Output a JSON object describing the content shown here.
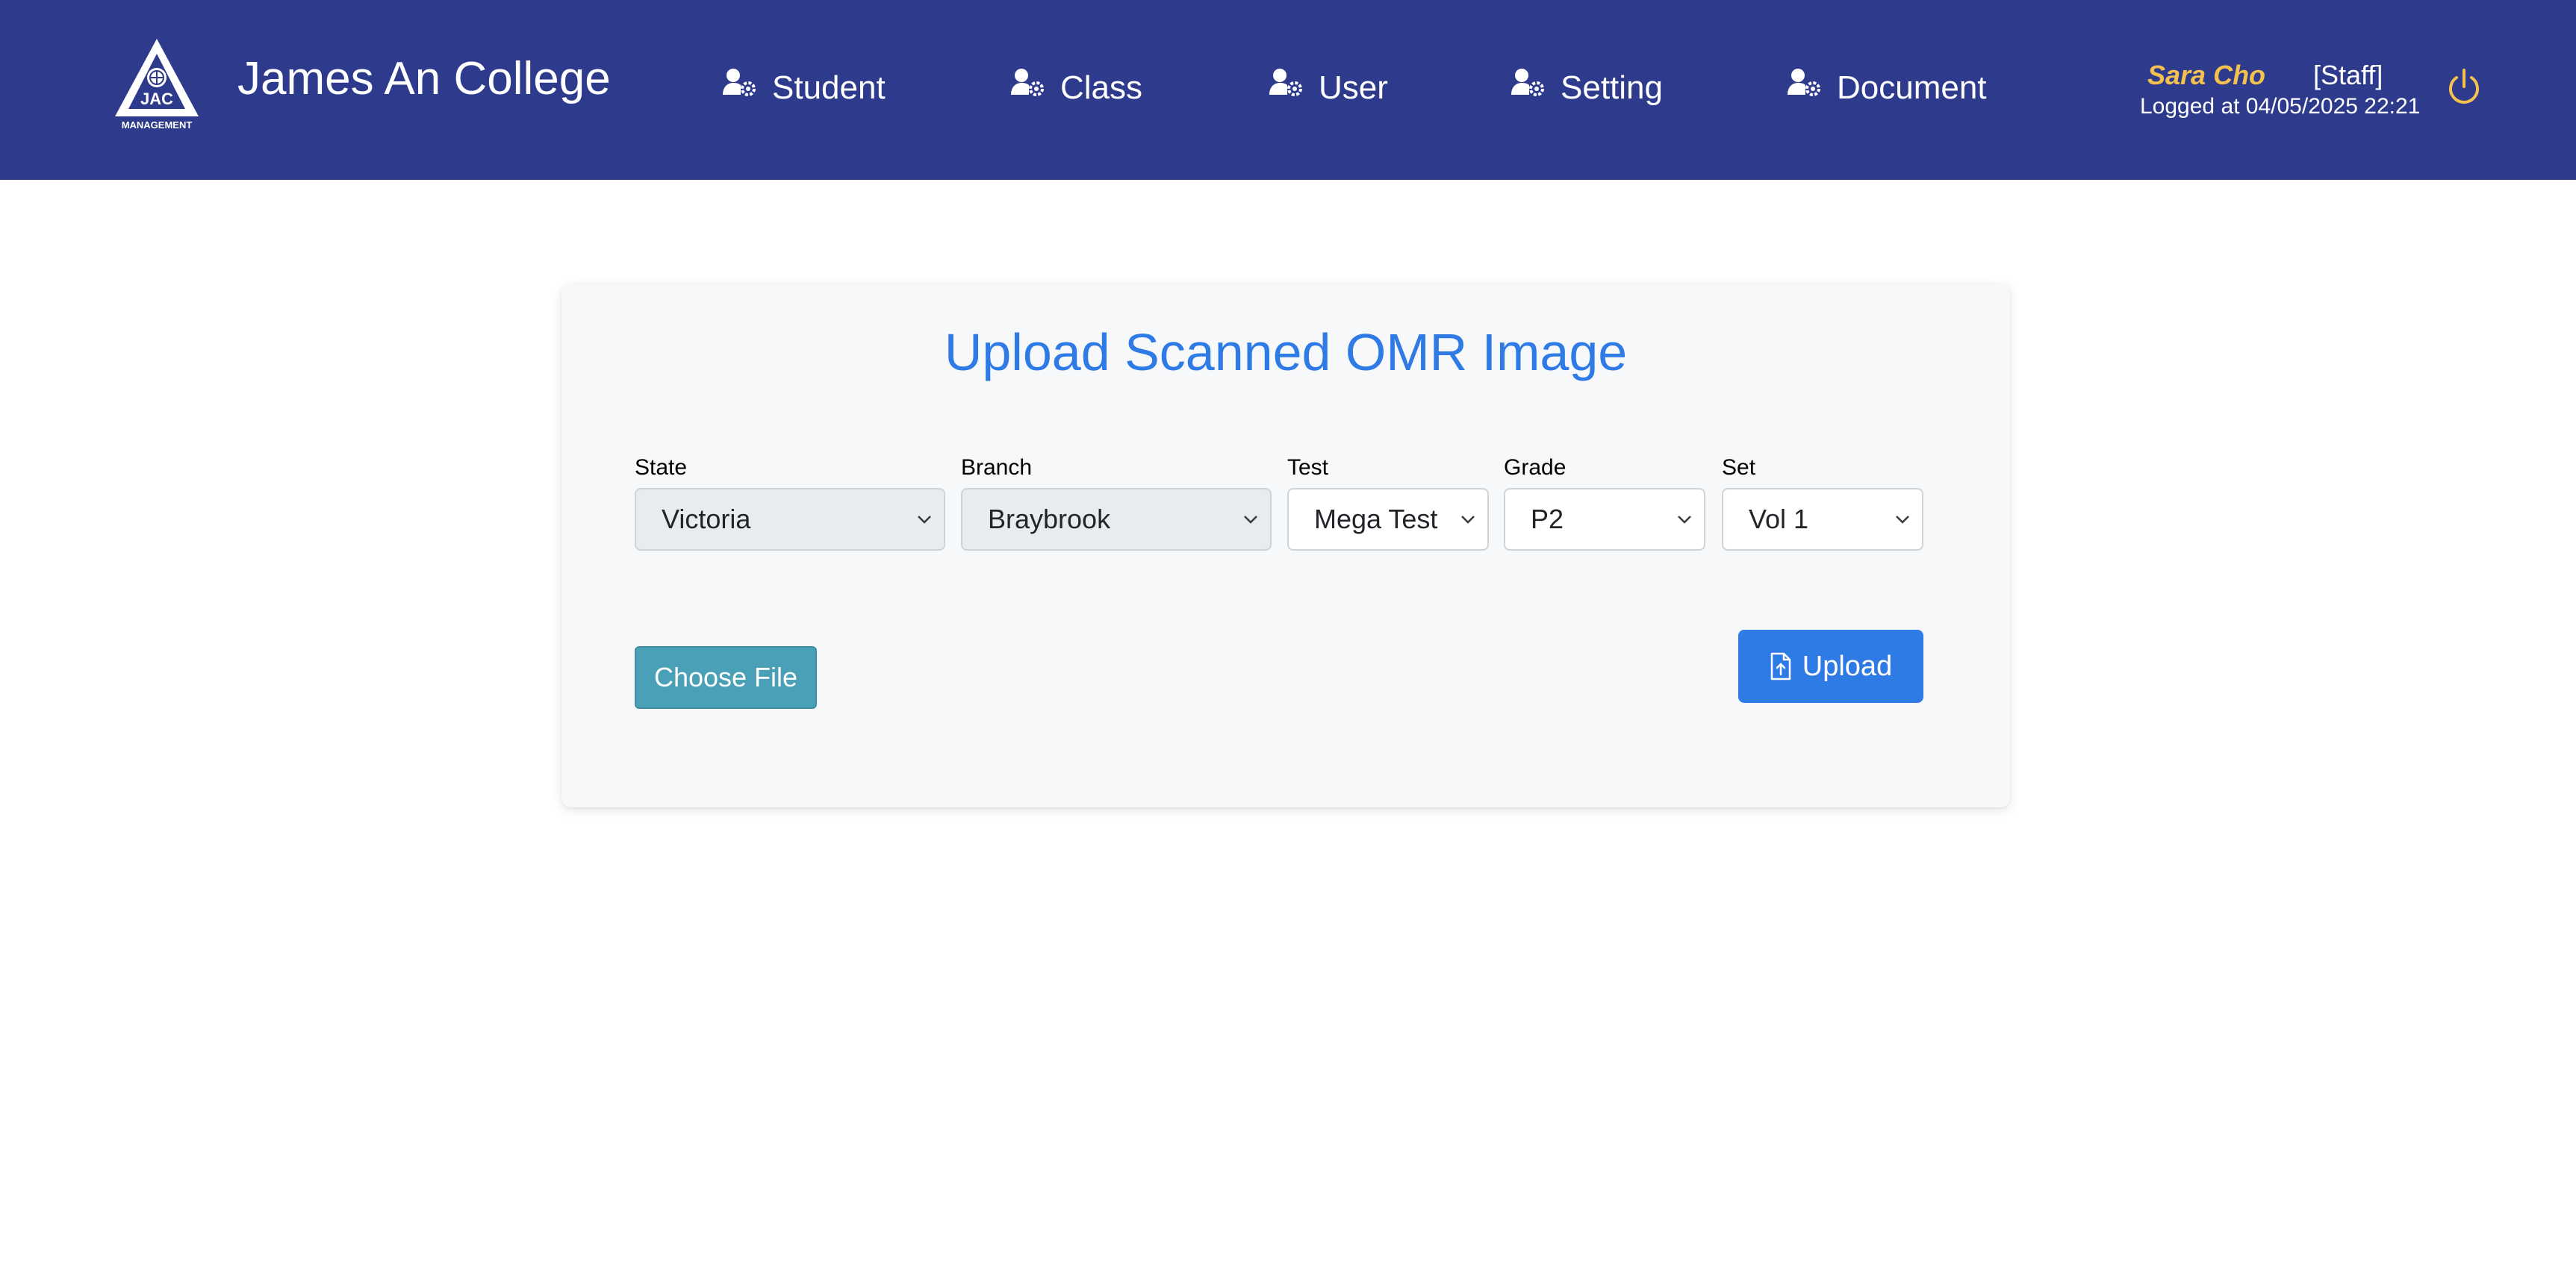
{
  "header": {
    "logo_text": "JAC",
    "logo_subtext": "MANAGEMENT",
    "title": "James An College",
    "nav": [
      {
        "label": "Student",
        "icon": "user-gear-icon"
      },
      {
        "label": "Class",
        "icon": "user-gear-icon"
      },
      {
        "label": "User",
        "icon": "user-gear-icon"
      },
      {
        "label": "Setting",
        "icon": "user-gear-icon"
      },
      {
        "label": "Document",
        "icon": "user-gear-icon"
      }
    ],
    "user": {
      "name": "Sara Cho",
      "role": "[Staff]",
      "logged_at": "Logged at 04/05/2025 22:21",
      "logout_icon": "power-icon"
    }
  },
  "form": {
    "title": "Upload Scanned OMR Image",
    "fields": {
      "state": {
        "label": "State",
        "value": "Victoria"
      },
      "branch": {
        "label": "Branch",
        "value": "Braybrook"
      },
      "test": {
        "label": "Test",
        "value": "Mega Test"
      },
      "grade": {
        "label": "Grade",
        "value": "P2"
      },
      "set": {
        "label": "Set",
        "value": "Vol 1"
      }
    },
    "choose_file_label": "Choose File",
    "upload_label": "Upload",
    "upload_icon": "file-upload-icon"
  },
  "colors": {
    "header_bg": "#2e3a8c",
    "accent_blue": "#2f7be6",
    "user_name": "#f4c04e",
    "choose_file_bg": "#4aa0b6"
  }
}
